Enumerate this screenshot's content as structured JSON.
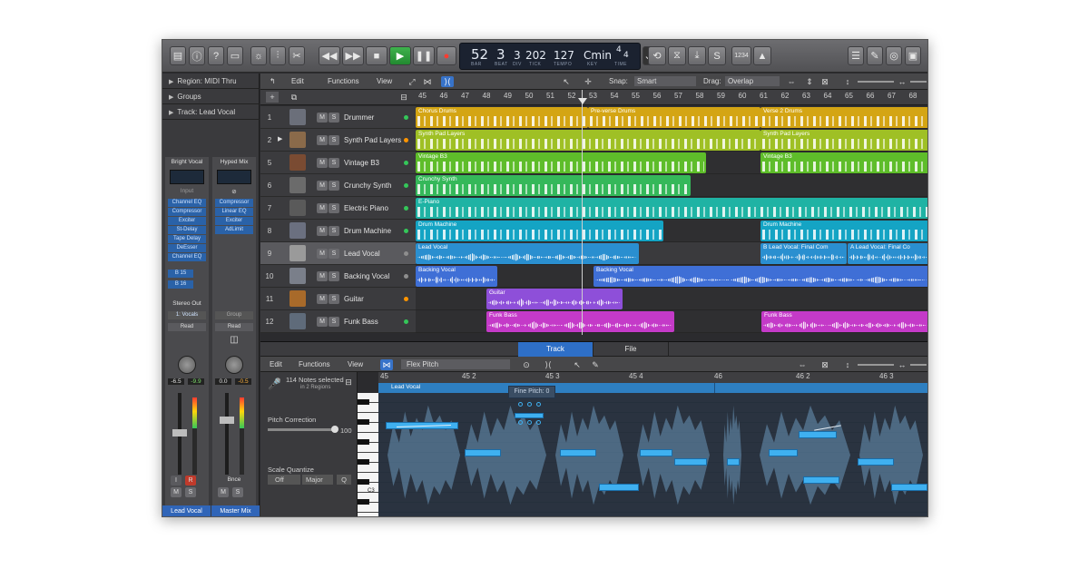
{
  "lcd": {
    "bar": "52",
    "beat": "3",
    "div": "3",
    "tick": "202",
    "tempo": "127",
    "key": "Cmin",
    "sig_top": "4",
    "sig_bottom": "4",
    "lbl_bar": "BAR",
    "lbl_beat": "BEAT",
    "lbl_div": "DIV",
    "lbl_tick": "TICK",
    "lbl_tempo": "TEMPO",
    "lbl_key": "KEY",
    "lbl_sig": "TIME"
  },
  "control": {
    "count_in": "1234"
  },
  "inspector": {
    "region": "Region: MIDI Thru",
    "groups": "Groups",
    "track": "Track: Lead Vocal",
    "strip1": {
      "setting": "Bright Vocal",
      "input": "Input",
      "plugins": [
        "Channel EQ",
        "Compressor",
        "Exciter",
        "St-Delay",
        "Tape Delay",
        "DeEsser",
        "Channel EQ"
      ],
      "sends": [
        "B 15",
        "B 16"
      ],
      "output": "Stereo Out",
      "group": "1: Vocals",
      "auto": "Read",
      "vol": "-6.5",
      "peak": "-9.9",
      "name": "Lead Vocal"
    },
    "strip2": {
      "setting": "Hyped Mix",
      "plugins": [
        "Compressor",
        "Linear EQ",
        "Exciter",
        "AdLimit"
      ],
      "group": "Group",
      "auto": "Read",
      "vol": "0.0",
      "peak": "-0.5",
      "bnce": "Bnce",
      "name": "Master Mix"
    },
    "mute": "M",
    "solo": "S",
    "rec": "I",
    "rec2": "R"
  },
  "menubar": {
    "edit": "Edit",
    "functions": "Functions",
    "view": "View",
    "snap_label": "Snap:",
    "snap_value": "Smart",
    "drag_label": "Drag:",
    "drag_value": "Overlap"
  },
  "ruler": [
    "45",
    "46",
    "47",
    "48",
    "49",
    "50",
    "51",
    "52",
    "53",
    "54",
    "55",
    "56",
    "57",
    "58",
    "59",
    "60",
    "61",
    "62",
    "63",
    "64",
    "65",
    "66",
    "67",
    "68"
  ],
  "tracks": [
    {
      "num": "1",
      "name": "Drummer",
      "dot": "#34c759"
    },
    {
      "num": "2",
      "name": "Synth Pad Layers",
      "dot": "#ff9500"
    },
    {
      "num": "5",
      "name": "Vintage B3",
      "dot": "#34c759"
    },
    {
      "num": "6",
      "name": "Crunchy Synth",
      "dot": "#34c759"
    },
    {
      "num": "7",
      "name": "Electric Piano",
      "dot": "#34c759"
    },
    {
      "num": "8",
      "name": "Drum Machine",
      "dot": "#34c759"
    },
    {
      "num": "9",
      "name": "Lead Vocal",
      "dot": "#8e8e8e"
    },
    {
      "num": "10",
      "name": "Backing Vocal",
      "dot": "#8e8e8e"
    },
    {
      "num": "11",
      "name": "Guitar",
      "dot": "#ff9500"
    },
    {
      "num": "12",
      "name": "Funk Bass",
      "dot": "#34c759"
    }
  ],
  "regions": {
    "chorus_drums": "Chorus Drums",
    "preverse_drums": "Pre-verse Drums",
    "verse2_drums": "Verse 2 Drums",
    "synth_pad_a": "Synth Pad Layers",
    "synth_pad_b": "Synth Pad Layers",
    "vintage_a": "Vintage B3",
    "vintage_b": "Vintage B3",
    "crunchy": "Crunchy Synth",
    "epiano": "E-Piano",
    "drum_machine_a": "Drum Machine",
    "drum_machine_b": "Drum Machine",
    "lead_vocal": "Lead Vocal",
    "lead_comp_a": "B  Lead Vocal: Final Com",
    "lead_comp_b": "A  Lead Vocal: Final Co",
    "backing_a": "Backing Vocal",
    "backing_b": "Backing Vocal",
    "guitar": "Guitar",
    "funk_a": "Funk Bass",
    "funk_b": "Funk Bass"
  },
  "colors": {
    "drums": "#d4a514",
    "synthpad": "#9fc025",
    "vintage": "#5ebd2a",
    "crunchy": "#35b85a",
    "epiano": "#1fb3a4",
    "drum_machine": "#14a4c4",
    "lead": "#2a8fd0",
    "backing": "#3f6fd6",
    "guitar": "#8e4fd9",
    "funk": "#c43ac8"
  },
  "editor": {
    "tab_track": "Track",
    "tab_file": "File",
    "edit": "Edit",
    "functions": "Functions",
    "view": "View",
    "mode": "Flex Pitch",
    "notes_selected": "114 Notes selected",
    "in_regions": "in 2 Regions",
    "pitch_correction": "Pitch Correction",
    "pitch_value": "100",
    "scale_quantize": "Scale Quantize",
    "sq_off": "Off",
    "sq_major": "Major",
    "sq_q": "Q",
    "ruler": [
      "45",
      "45 2",
      "45 3",
      "45 4",
      "46",
      "46 2",
      "46 3"
    ],
    "region": "Lead Vocal",
    "fine_pitch": "Fine Pitch: 0",
    "c3": "C3"
  }
}
